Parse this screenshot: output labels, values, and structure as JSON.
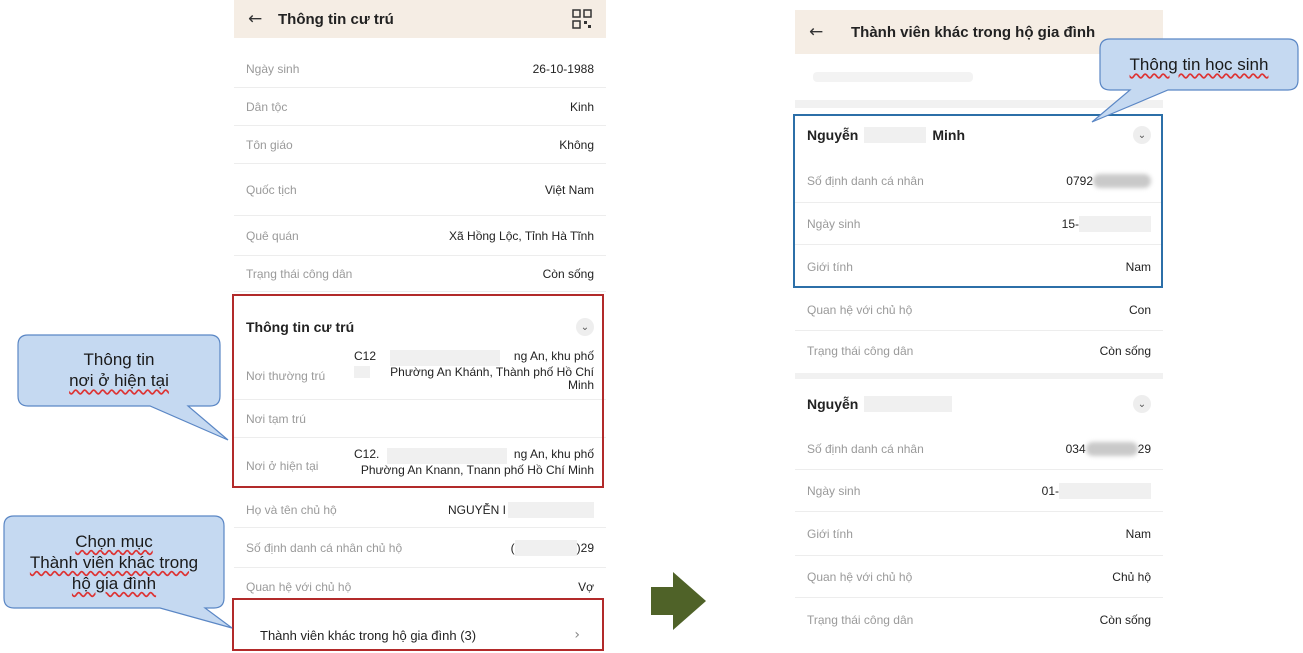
{
  "left": {
    "header_title": "Thông tin cư trú",
    "rows": [
      {
        "label": "Ngày sinh",
        "value": "26-10-1988"
      },
      {
        "label": "Dân tộc",
        "value": "Kinh"
      },
      {
        "label": "Tôn giáo",
        "value": "Không"
      },
      {
        "label": "Quốc tịch",
        "value": "Việt Nam"
      },
      {
        "label": "Quê quán",
        "value": "Xã Hồng Lộc, Tỉnh Hà Tĩnh"
      },
      {
        "label": "Trạng thái công dân",
        "value": "Còn sống"
      }
    ],
    "residence": {
      "title": "Thông tin cư trú",
      "permanent_label": "Nơi thường trú",
      "permanent_line1_a": "C12",
      "permanent_line1_b": "ng An, khu phố",
      "permanent_line2": "Phường An Khánh, Thành phố Hồ Chí",
      "permanent_line3": "Minh",
      "temporary_label": "Nơi tạm trú",
      "current_label": "Nơi ở hiện tại",
      "current_line1_a": "C12.",
      "current_line1_b": "ng An, khu phố",
      "current_line2": "Phường An Knann, Tnann phố Hồ Chí Minh"
    },
    "household": [
      {
        "label": "Họ và tên chủ hộ",
        "value": "NGUYỄN I"
      },
      {
        "label": "Số định danh cá nhân chủ hộ",
        "value_a": "(",
        "value_b": ")29"
      },
      {
        "label": "Quan hệ với chủ hộ",
        "value": "Vợ"
      }
    ],
    "family_link": "Thành viên khác trong hộ gia đình (3)"
  },
  "right": {
    "header_title": "Thành viên khác trong hộ gia đình",
    "member1": {
      "name_a": "Nguyễn",
      "name_b": "Minh",
      "rows": [
        {
          "label": "Số định danh cá nhân",
          "value": "0792"
        },
        {
          "label": "Ngày sinh",
          "value": "15-"
        },
        {
          "label": "Giới tính",
          "value": "Nam"
        },
        {
          "label": "Quan hệ với chủ hộ",
          "value": "Con"
        },
        {
          "label": "Trạng thái công dân",
          "value": "Còn sống"
        }
      ]
    },
    "member2": {
      "name_a": "Nguyễn",
      "rows": [
        {
          "label": "Số định danh cá nhân",
          "value_a": "034",
          "value_b": "29"
        },
        {
          "label": "Ngày sinh",
          "value": "01-"
        },
        {
          "label": "Giới tính",
          "value": "Nam"
        },
        {
          "label": "Quan hệ với chủ hộ",
          "value": "Chủ hộ"
        },
        {
          "label": "Trạng thái công dân",
          "value": "Còn sống"
        }
      ]
    }
  },
  "callouts": {
    "residence_line1": "Thông tin",
    "residence_line2": "nơi ở hiện tại",
    "select_line1": "Chọn mục",
    "select_line2": "Thành viên khác trong",
    "select_line3": "hộ gia đình",
    "student": "Thông tin học sinh"
  },
  "colors": {
    "callout_fill": "#c5d9f1",
    "callout_stroke": "#5b87c5",
    "red_box": "#b22a2a",
    "blue_box": "#2c6fa8",
    "arrow": "#4f6228",
    "header_bg": "#f5ede4"
  },
  "icons": [
    "back-arrow-icon",
    "qr-code-icon",
    "chevron-down-icon",
    "chevron-right-icon",
    "right-arrow-icon"
  ]
}
